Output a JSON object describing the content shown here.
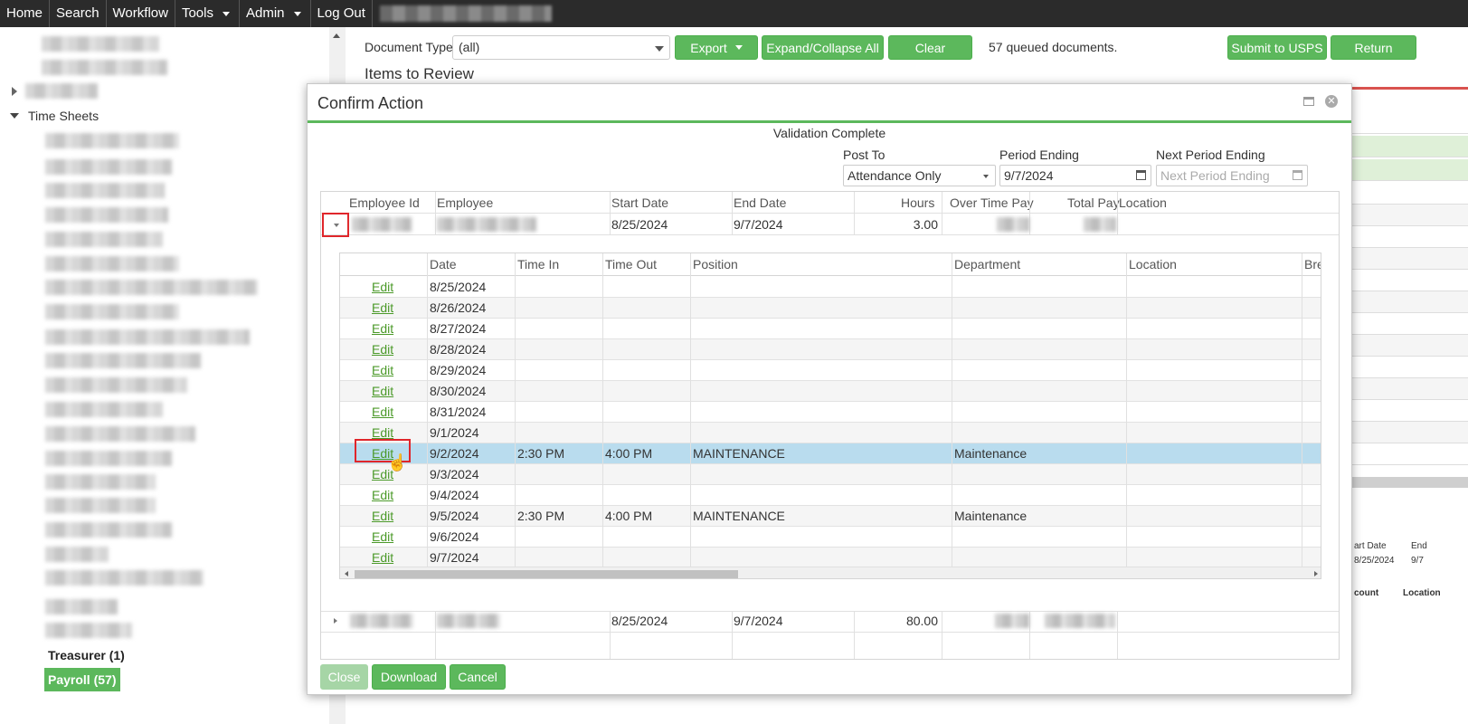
{
  "nav": {
    "home": "Home",
    "search": "Search",
    "workflow": "Workflow",
    "tools": "Tools",
    "admin": "Admin",
    "logout": "Log Out"
  },
  "sidebar": {
    "time_sheets": "Time Sheets",
    "treasurer": "Treasurer (1)",
    "payroll": "Payroll (57)"
  },
  "toolbar": {
    "doc_type_label": "Document Type",
    "doc_type_value": "(all)",
    "export": "Export",
    "expand_collapse": "Expand/Collapse All",
    "clear": "Clear",
    "queued": "57 queued documents.",
    "submit_usps": "Submit to USPS",
    "return": "Return",
    "items_to_review": "Items to Review"
  },
  "background_right": {
    "start_date_hdr": "art Date",
    "end_hdr": "End",
    "start_date_val": "8/25/2024",
    "end_val": "9/7",
    "account_hdr": "count",
    "location_hdr": "Location"
  },
  "modal": {
    "title": "Confirm Action",
    "validation": "Validation Complete",
    "post_to_label": "Post To",
    "post_to_value": "Attendance Only",
    "period_ending_label": "Period Ending",
    "period_ending_value": "9/7/2024",
    "next_period_label": "Next Period Ending",
    "next_period_placeholder": "Next Period Ending",
    "buttons": {
      "close": "Close",
      "download": "Download",
      "cancel": "Cancel"
    },
    "outer_headers": [
      "Employee Id",
      "Employee",
      "Start Date",
      "End Date",
      "Hours",
      "Over Time Pay",
      "Total Pay",
      "Location"
    ],
    "outer_rows": [
      {
        "start": "8/25/2024",
        "end": "9/7/2024",
        "hours": "3.00"
      },
      {
        "start": "8/25/2024",
        "end": "9/7/2024",
        "hours": "80.00"
      }
    ],
    "inner_headers": [
      "Date",
      "Time In",
      "Time Out",
      "Position",
      "Department",
      "Location",
      "Bre"
    ],
    "edit_label": "Edit",
    "inner_rows": [
      {
        "date": "8/25/2024",
        "time_in": "",
        "time_out": "",
        "position": "",
        "department": ""
      },
      {
        "date": "8/26/2024",
        "time_in": "",
        "time_out": "",
        "position": "",
        "department": ""
      },
      {
        "date": "8/27/2024",
        "time_in": "",
        "time_out": "",
        "position": "",
        "department": ""
      },
      {
        "date": "8/28/2024",
        "time_in": "",
        "time_out": "",
        "position": "",
        "department": ""
      },
      {
        "date": "8/29/2024",
        "time_in": "",
        "time_out": "",
        "position": "",
        "department": ""
      },
      {
        "date": "8/30/2024",
        "time_in": "",
        "time_out": "",
        "position": "",
        "department": ""
      },
      {
        "date": "8/31/2024",
        "time_in": "",
        "time_out": "",
        "position": "",
        "department": ""
      },
      {
        "date": "9/1/2024",
        "time_in": "",
        "time_out": "",
        "position": "",
        "department": ""
      },
      {
        "date": "9/2/2024",
        "time_in": "2:30 PM",
        "time_out": "4:00 PM",
        "position": "MAINTENANCE",
        "department": "Maintenance"
      },
      {
        "date": "9/3/2024",
        "time_in": "",
        "time_out": "",
        "position": "",
        "department": ""
      },
      {
        "date": "9/4/2024",
        "time_in": "",
        "time_out": "",
        "position": "",
        "department": ""
      },
      {
        "date": "9/5/2024",
        "time_in": "2:30 PM",
        "time_out": "4:00 PM",
        "position": "MAINTENANCE",
        "department": "Maintenance"
      },
      {
        "date": "9/6/2024",
        "time_in": "",
        "time_out": "",
        "position": "",
        "department": ""
      },
      {
        "date": "9/7/2024",
        "time_in": "",
        "time_out": "",
        "position": "",
        "department": ""
      }
    ],
    "selected_row_index": 8
  },
  "colors": {
    "accent_green": "#5cb85c",
    "highlight_red": "#e0262b",
    "selected_row": "#b9dcee"
  }
}
